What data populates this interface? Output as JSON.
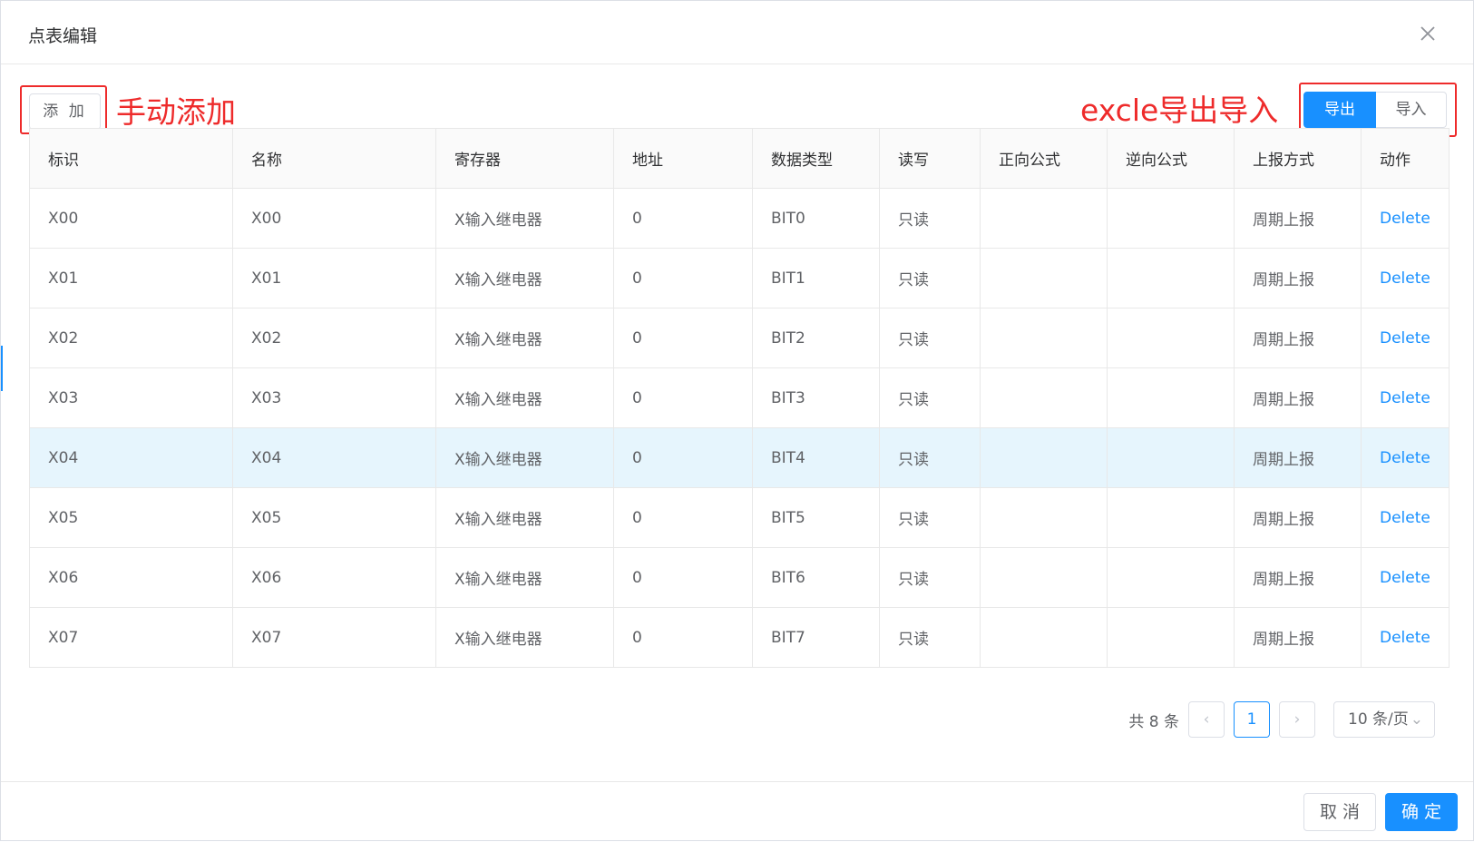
{
  "dialog": {
    "title": "点表编辑",
    "close_icon": "close-icon"
  },
  "toolbar": {
    "add_label": "添 加",
    "export_label": "导出",
    "import_label": "导入"
  },
  "annotations": {
    "manual_add": "手动添加",
    "excel_io": "excle导出导入",
    "color": "#ee2b2b"
  },
  "table": {
    "columns": [
      "标识",
      "名称",
      "寄存器",
      "地址",
      "数据类型",
      "读写",
      "正向公式",
      "逆向公式",
      "上报方式",
      "动作"
    ],
    "rows": [
      {
        "id": "X00",
        "name": "X00",
        "register": "X输入继电器",
        "address": "0",
        "type": "BIT0",
        "rw": "只读",
        "forward": "",
        "reverse": "",
        "report": "周期上报",
        "action": "Delete"
      },
      {
        "id": "X01",
        "name": "X01",
        "register": "X输入继电器",
        "address": "0",
        "type": "BIT1",
        "rw": "只读",
        "forward": "",
        "reverse": "",
        "report": "周期上报",
        "action": "Delete"
      },
      {
        "id": "X02",
        "name": "X02",
        "register": "X输入继电器",
        "address": "0",
        "type": "BIT2",
        "rw": "只读",
        "forward": "",
        "reverse": "",
        "report": "周期上报",
        "action": "Delete"
      },
      {
        "id": "X03",
        "name": "X03",
        "register": "X输入继电器",
        "address": "0",
        "type": "BIT3",
        "rw": "只读",
        "forward": "",
        "reverse": "",
        "report": "周期上报",
        "action": "Delete"
      },
      {
        "id": "X04",
        "name": "X04",
        "register": "X输入继电器",
        "address": "0",
        "type": "BIT4",
        "rw": "只读",
        "forward": "",
        "reverse": "",
        "report": "周期上报",
        "action": "Delete"
      },
      {
        "id": "X05",
        "name": "X05",
        "register": "X输入继电器",
        "address": "0",
        "type": "BIT5",
        "rw": "只读",
        "forward": "",
        "reverse": "",
        "report": "周期上报",
        "action": "Delete"
      },
      {
        "id": "X06",
        "name": "X06",
        "register": "X输入继电器",
        "address": "0",
        "type": "BIT6",
        "rw": "只读",
        "forward": "",
        "reverse": "",
        "report": "周期上报",
        "action": "Delete"
      },
      {
        "id": "X07",
        "name": "X07",
        "register": "X输入继电器",
        "address": "0",
        "type": "BIT7",
        "rw": "只读",
        "forward": "",
        "reverse": "",
        "report": "周期上报",
        "action": "Delete"
      }
    ],
    "highlighted_row": 4
  },
  "pagination": {
    "total_label": "共 8 条",
    "prev_icon": "chevron-left-icon",
    "current_page": "1",
    "next_icon": "chevron-right-icon",
    "page_size": "10 条/页",
    "dropdown_icon": "chevron-down-icon"
  },
  "footer": {
    "cancel_label": "取 消",
    "ok_label": "确 定"
  },
  "colors": {
    "primary": "#1890ff",
    "highlight_row": "#e6f5fd",
    "annotation": "#ee2b2b"
  }
}
